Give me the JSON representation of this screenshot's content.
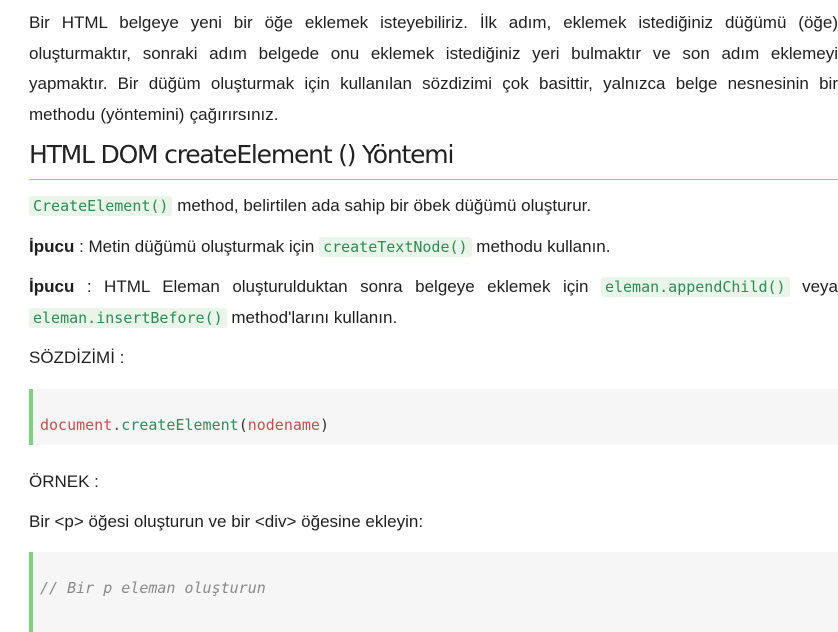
{
  "intro": "Bir HTML belgeye yeni bir öğe eklemek isteyebiliriz. İlk adım, eklemek istediğiniz düğümü (öğe) oluşturmaktır, sonraki adım belgede onu eklemek istediğiniz yeri bulmaktır ve son adım eklemeyi yapmaktır. Bir düğüm oluşturmak için kullanılan sözdizimi çok basittir, yalnızca belge nesnesinin bir methodu (yöntemini) çağırırsınız.",
  "section_title": "HTML DOM createElement () Yöntemi",
  "para1": {
    "code": "CreateElement()",
    "text": " method, belirtilen ada sahip bir öbek düğümü oluşturur."
  },
  "tip1": {
    "label": "İpucu",
    "text_before": " : Metin düğümü oluşturmak için ",
    "code": "createTextNode()",
    "text_after": " methodu kullanın."
  },
  "tip2": {
    "label": "İpucu",
    "text_before": " : HTML Eleman oluşturulduktan sonra belgeye eklemek için ",
    "code1": "eleman.appendChild()",
    "text_mid": " veya ",
    "code2": "eleman.insertBefore()",
    "text_after": " method'larını kullanın."
  },
  "syntax_heading": "SÖZDİZİMİ :",
  "syntax_code": {
    "object": "document",
    "dot": ".",
    "fn": "createElement",
    "open": "(",
    "arg": "nodename",
    "close": ")"
  },
  "example_heading": "ÖRNEK :",
  "example_desc": "Bir <p> öğesi oluşturun ve bir <div> öğesine ekleyin:",
  "example_code": {
    "comment": "// Bir p eleman oluşturun"
  },
  "colors": {
    "code_bg": "#e8f5e8",
    "code_fg": "#2e8b57",
    "block_bg": "#f6f6f6",
    "block_border": "#7dd07d",
    "title_rule": "#d9b24a"
  }
}
